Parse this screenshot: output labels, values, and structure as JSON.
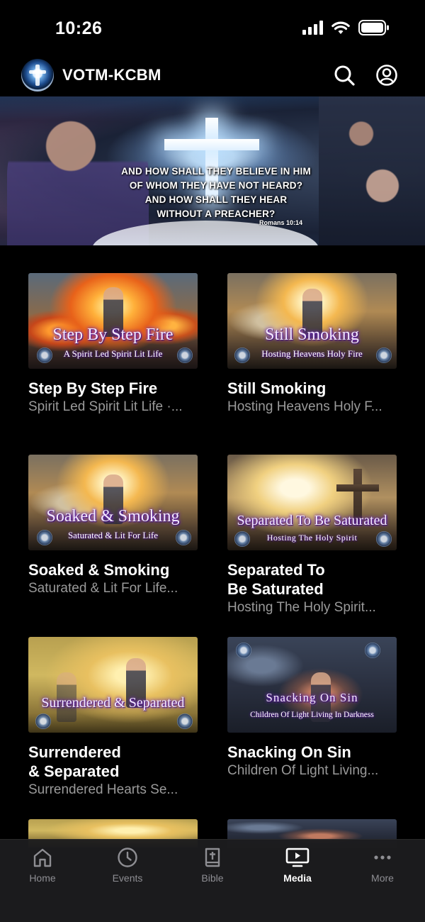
{
  "status_bar": {
    "time": "10:26"
  },
  "header": {
    "title": "VOTM-KCBM"
  },
  "banner": {
    "lines": [
      "AND HOW SHALL THEY BELIEVE IN HIM",
      "OF WHOM THEY HAVE NOT HEARD?",
      "AND HOW SHALL THEY HEAR",
      "WITHOUT A PREACHER?"
    ],
    "reference": "Romans 10:14"
  },
  "media_items": [
    {
      "thumb_title": "Step By Step Fire",
      "thumb_subtitle": "A Spirit Led Spirit Lit Life",
      "title": "Step By Step Fire",
      "subtitle": "Spirit Led Spirit Lit Life ·..."
    },
    {
      "thumb_title": "Still Smoking",
      "thumb_subtitle": "Hosting Heavens Holy Fire",
      "title": "Still Smoking",
      "subtitle": "Hosting Heavens Holy F..."
    },
    {
      "thumb_title": "Soaked & Smoking",
      "thumb_subtitle": "Saturated & Lit For Life",
      "title": "Soaked & Smoking",
      "subtitle": "Saturated & Lit For Life..."
    },
    {
      "thumb_title": "Separated To Be Saturated",
      "thumb_subtitle": "Hosting The Holy Spirit",
      "title_line1": "Separated To",
      "title_line2": "Be Saturated",
      "subtitle": "Hosting The Holy Spirit..."
    },
    {
      "thumb_title": "Surrendered & Separated",
      "thumb_subtitle": "",
      "title_line1": "Surrendered",
      "title_line2": "& Separated",
      "subtitle": "Surrendered Hearts Se..."
    },
    {
      "thumb_title": "Snacking On Sin",
      "thumb_subtitle": "Children Of Light Living In Darkness",
      "title": "Snacking On Sin",
      "subtitle": "Children Of Light Living..."
    }
  ],
  "tabs": [
    {
      "label": "Home",
      "icon": "home-icon",
      "active": false
    },
    {
      "label": "Events",
      "icon": "clock-icon",
      "active": false
    },
    {
      "label": "Bible",
      "icon": "bible-icon",
      "active": false
    },
    {
      "label": "Media",
      "icon": "media-icon",
      "active": true
    },
    {
      "label": "More",
      "icon": "more-icon",
      "active": false
    }
  ],
  "colors": {
    "background": "#000000",
    "tabbar": "#1c1c1e",
    "inactive_tab": "#8e8e93",
    "subtitle": "#9a9a9a"
  }
}
